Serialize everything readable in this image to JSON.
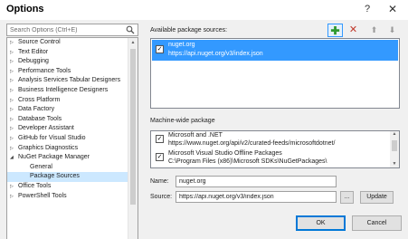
{
  "window": {
    "title": "Options",
    "help_label": "?",
    "close_label": "✕"
  },
  "search": {
    "placeholder": "Search Options (Ctrl+E)"
  },
  "tree": {
    "items": [
      {
        "label": "Source Control"
      },
      {
        "label": "Text Editor"
      },
      {
        "label": "Debugging"
      },
      {
        "label": "Performance Tools"
      },
      {
        "label": "Analysis Services Tabular Designers"
      },
      {
        "label": "Business Intelligence Designers"
      },
      {
        "label": "Cross Platform"
      },
      {
        "label": "Data Factory"
      },
      {
        "label": "Database Tools"
      },
      {
        "label": "Developer Assistant"
      },
      {
        "label": "GitHub for Visual Studio"
      },
      {
        "label": "Graphics Diagnostics"
      },
      {
        "label": "NuGet Package Manager"
      },
      {
        "label": "General"
      },
      {
        "label": "Package Sources"
      },
      {
        "label": "Office Tools"
      },
      {
        "label": "PowerShell Tools"
      }
    ]
  },
  "available_sources": {
    "heading": "Available package sources:",
    "items": [
      {
        "name": "nuget.org",
        "url": "https://api.nuget.org/v3/index.json",
        "checked": true
      }
    ]
  },
  "machine_wide": {
    "heading": "Machine-wide package",
    "items": [
      {
        "name": "Microsoft and .NET",
        "url": "https://www.nuget.org/api/v2/curated-feeds/microsoftdotnet/",
        "checked": true
      },
      {
        "name": "Microsoft Visual Studio Offline Packages",
        "url": "C:\\Program Files (x86)\\Microsoft SDKs\\NuGetPackages\\",
        "checked": true
      }
    ]
  },
  "form": {
    "name_label": "Name:",
    "name_value": "nuget.org",
    "source_label": "Source:",
    "source_value": "https://api.nuget.org/v3/index.json",
    "browse_label": "...",
    "update_label": "Update"
  },
  "footer": {
    "ok_label": "OK",
    "cancel_label": "Cancel"
  },
  "colors": {
    "selection": "#3399ff",
    "tree_selection": "#cce8ff",
    "dialog_bg": "#f0f0f0",
    "add_icon": "#2f9a2f",
    "remove_icon": "#c0392b"
  },
  "icons": {
    "add": "plus-icon",
    "remove": "x-icon",
    "move_up": "arrow-up-icon",
    "move_down": "arrow-down-icon",
    "search": "search-icon",
    "checkbox": "checkmark-icon"
  }
}
